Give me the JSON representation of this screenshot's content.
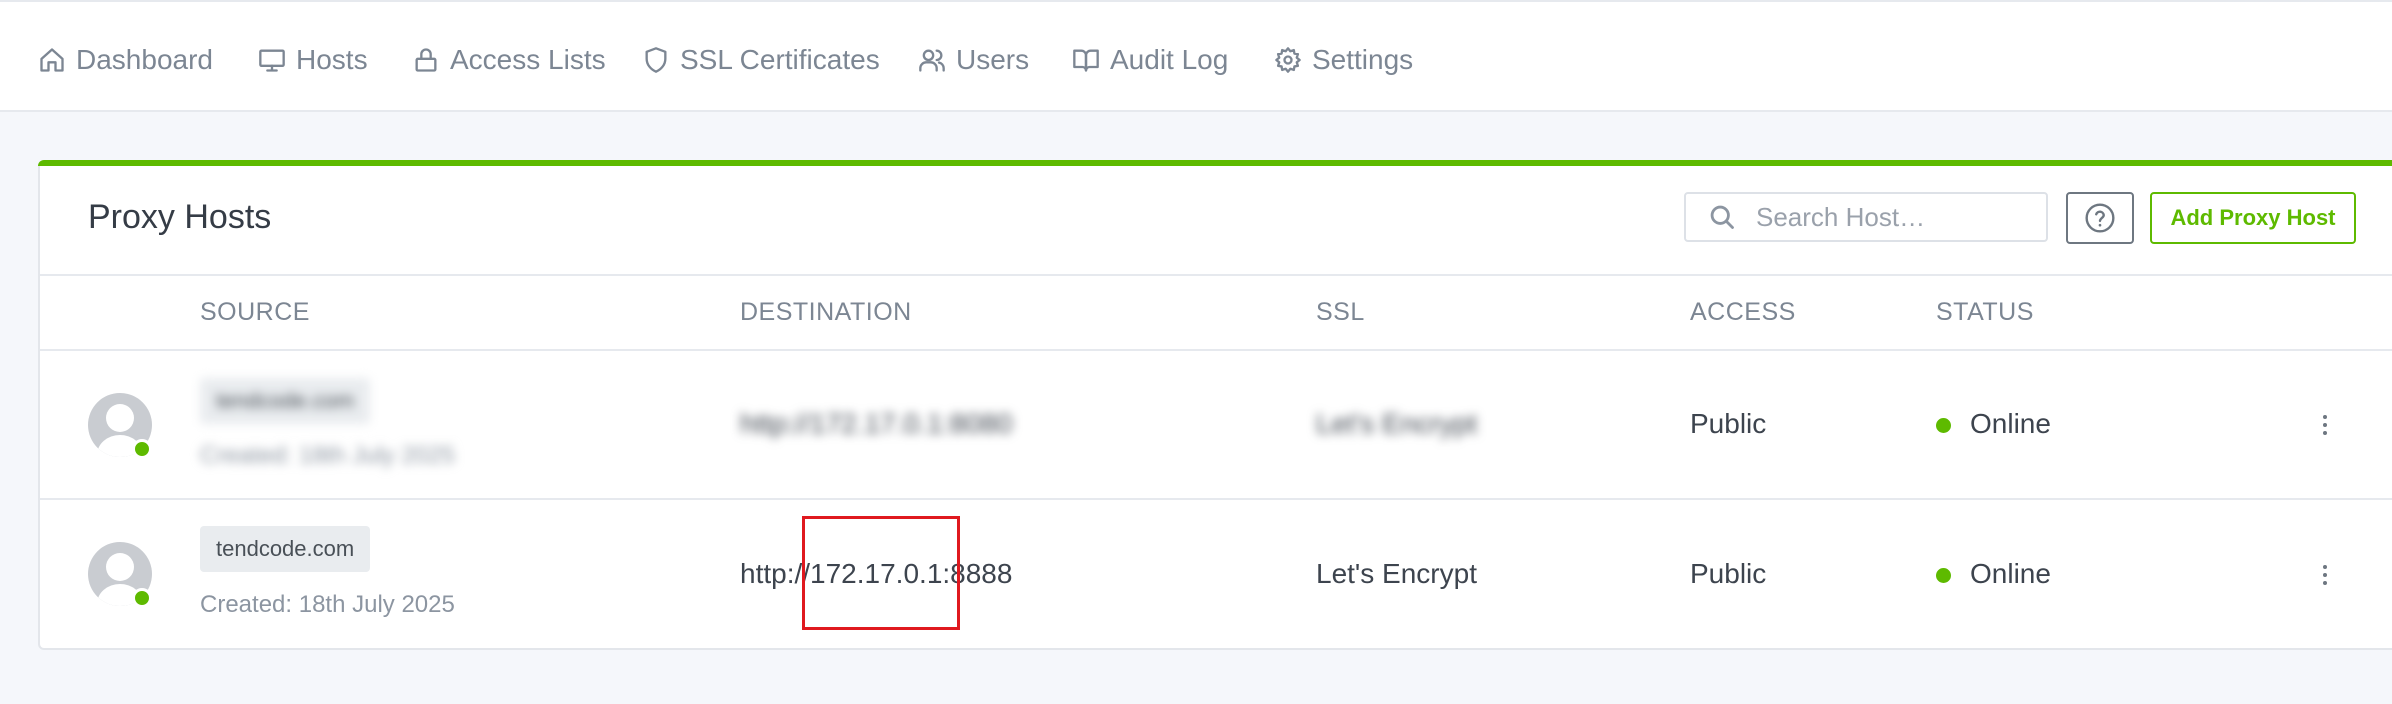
{
  "nav": {
    "items": [
      {
        "label": "Dashboard",
        "icon": "home-icon"
      },
      {
        "label": "Hosts",
        "icon": "monitor-icon"
      },
      {
        "label": "Access Lists",
        "icon": "lock-icon"
      },
      {
        "label": "SSL Certificates",
        "icon": "shield-icon"
      },
      {
        "label": "Users",
        "icon": "users-icon"
      },
      {
        "label": "Audit Log",
        "icon": "book-open-icon"
      },
      {
        "label": "Settings",
        "icon": "gear-icon"
      }
    ]
  },
  "card": {
    "title": "Proxy Hosts",
    "search_placeholder": "Search Host…",
    "help_icon": "help-circle-icon",
    "add_button": "Add Proxy Host",
    "accent_color": "#5eba00"
  },
  "table": {
    "columns": [
      "SOURCE",
      "DESTINATION",
      "SSL",
      "ACCESS",
      "STATUS"
    ],
    "rows": [
      {
        "source": "tendcode.com",
        "created": "Created: 18th July 2025",
        "destination": "http://172.17.0.1:8080",
        "ssl": "Let's Encrypt",
        "access": "Public",
        "status": "Online",
        "blurred": true
      },
      {
        "source": "tendcode.com",
        "created": "Created: 18th July 2025",
        "destination": "http://172.17.0.1:8888",
        "ssl": "Let's Encrypt",
        "access": "Public",
        "status": "Online",
        "blurred": false
      }
    ]
  },
  "status_color": "#5eba00",
  "highlight_color": "#e0191f"
}
